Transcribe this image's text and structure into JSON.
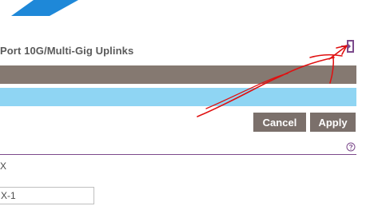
{
  "header": {
    "title": "Port 10G/Multi-Gig Uplinks",
    "logout_icon": "logout-door-icon"
  },
  "colors": {
    "banner_blue": "#1e88d8",
    "header_bar": "#857971",
    "row_highlight": "#8fd5f3",
    "button_bg": "#7b706b",
    "divider": "#7c4a8c",
    "annotation": "#e01010"
  },
  "actions": {
    "cancel_label": "Cancel",
    "apply_label": "Apply"
  },
  "form": {
    "help_icon": "help-question-icon",
    "field_label": "X",
    "field_value": "X-1"
  }
}
